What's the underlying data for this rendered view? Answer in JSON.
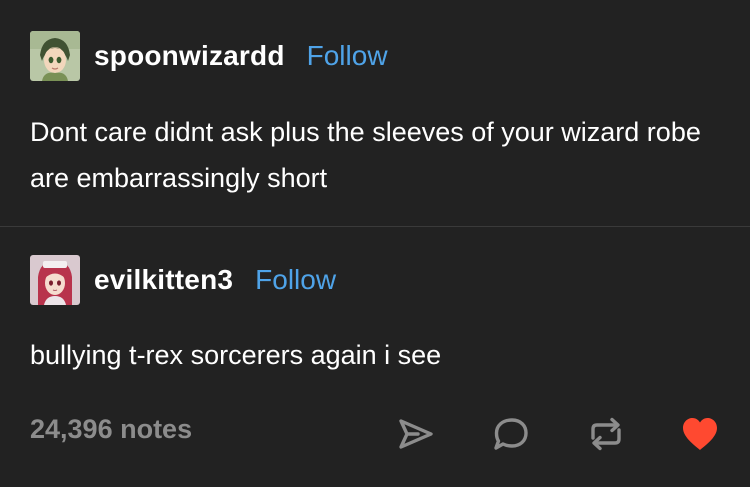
{
  "posts": [
    {
      "username": "spoonwizardd",
      "follow_label": "Follow",
      "text": "Dont care didnt ask plus the sleeves of your wizard robe are embarrassingly short"
    },
    {
      "username": "evilkitten3",
      "follow_label": "Follow",
      "text": "bullying t-rex sorcerers again i see"
    }
  ],
  "footer": {
    "notes": "24,396 notes",
    "actions": [
      {
        "name": "share",
        "icon": "paper-plane-icon"
      },
      {
        "name": "reply",
        "icon": "speech-bubble-icon"
      },
      {
        "name": "reblog",
        "icon": "reblog-arrows-icon"
      },
      {
        "name": "like",
        "icon": "heart-icon",
        "state": "liked",
        "color": "#ff4930"
      }
    ]
  },
  "colors": {
    "background": "#222222",
    "text": "#ffffff",
    "follow": "#4fa3e8",
    "muted": "#8c8c8c",
    "liked": "#ff4930",
    "divider": "#3a3a3a"
  }
}
